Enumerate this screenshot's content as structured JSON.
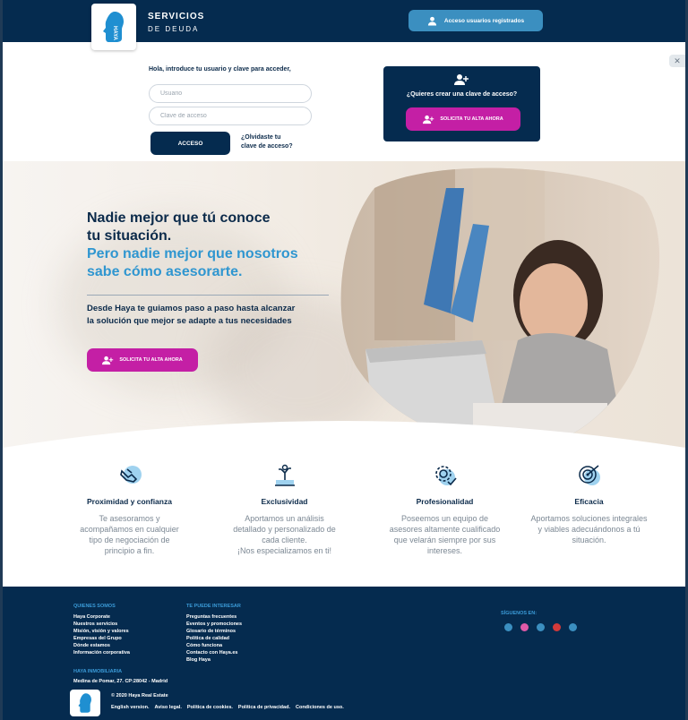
{
  "header": {
    "brand_line1": "SERVICIOS",
    "brand_line2": "DE DEUDA",
    "logo_text": "HAYA",
    "registered_button": "Acceso usuarios registrados"
  },
  "login": {
    "prompt": "Hola, introduce tu usuario y clave para acceder,",
    "username_placeholder": "Usuario",
    "password_placeholder": "Clave de acceso",
    "access_button": "ACCESO",
    "forgot_line1": "¿Olvidaste tu",
    "forgot_line2": "clave de acceso?"
  },
  "signup_box": {
    "question": "¿Quieres crear una clave de acceso?",
    "button": "SOLICITA TU ALTA AHORA"
  },
  "close_tab": "✕",
  "hero": {
    "title_line1": "Nadie mejor que tú conoce",
    "title_line2": "tu situación.",
    "subtitle_line1": "Pero nadie mejor que nosotros",
    "subtitle_line2": "sabe cómo asesorarte.",
    "desc_line1": "Desde Haya te guiamos paso a paso hasta alcanzar",
    "desc_line2": "la solución que mejor se adapte a tus necesidades",
    "button": "SOLICITA TU ALTA AHORA"
  },
  "features": [
    {
      "icon": "handshake-icon",
      "title": "Proximidad y confianza",
      "l1": "Te asesoramos y",
      "l2": "acompañamos en cualquier",
      "l3": "tipo de negociación de",
      "l4": "principio a fin."
    },
    {
      "icon": "growth-icon",
      "title": "Exclusividad",
      "l1": "Aportamos un análisis",
      "l2": "detallado y personalizado de",
      "l3": "cada cliente.",
      "l4": "¡Nos especializamos en ti!"
    },
    {
      "icon": "gear-check-icon",
      "title": "Profesionalidad",
      "l1": "Poseemos un equipo de",
      "l2": "asesores altamente cualificado",
      "l3": "que velarán siempre por sus",
      "l4": "intereses."
    },
    {
      "icon": "target-icon",
      "title": "Eficacia",
      "l1": "Aportamos soluciones integrales",
      "l2": "y viables adecuándonos a tú",
      "l3": "situación.",
      "l4": ""
    }
  ],
  "footer": {
    "col1_head": "QUIENES SOMOS",
    "col1_items": [
      "Haya Corporate",
      "Nuestros servicios",
      "Misión, visión y valores",
      "Empresas del Grupo",
      "Dónde estamos",
      "Información corporativa"
    ],
    "col2_head": "TE PUEDE INTERESAR",
    "col2_items": [
      "Preguntas frecuentes",
      "Eventos y promociones",
      "Glosario de términos",
      "Política de calidad",
      "Cómo funciona",
      "Contacto con Haya.es",
      "Blog Haya"
    ],
    "social_head": "SÍGUENOS EN:",
    "inmo_head": "HAYA INMOBILIARIA",
    "address": "Medina de Pomar, 27.  CP:28042 - Madrid",
    "copyright": "© 2020 Haya Real Estate",
    "links": [
      "English version.",
      "Aviso legal.",
      "Política de cookies.",
      "Política de privacidad.",
      "Condiciones de uso."
    ]
  },
  "colors": {
    "navy": "#052b4f",
    "accent_blue": "#2f96d0",
    "magenta": "#c41fa5"
  }
}
